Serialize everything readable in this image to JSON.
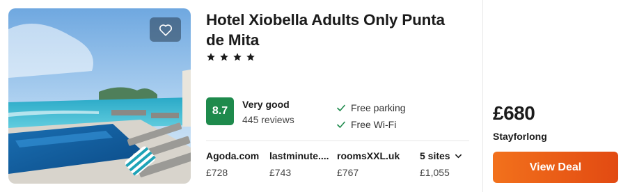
{
  "hotel": {
    "name": "Hotel Xiobella Adults Only Punta de Mita",
    "star_count": 4,
    "star_glyph": "★"
  },
  "rating": {
    "score": "8.7",
    "label": "Very good",
    "reviews": "445 reviews",
    "badge_color": "#1e8a4c"
  },
  "amenities": [
    {
      "label": "Free parking",
      "icon": "check-icon"
    },
    {
      "label": "Free Wi-Fi",
      "icon": "check-icon"
    }
  ],
  "deals": [
    {
      "site": "Agoda.com",
      "price": "£728"
    },
    {
      "site": "lastminute....",
      "price": "£743"
    },
    {
      "site": "roomsXXL.uk",
      "price": "£767"
    }
  ],
  "more_sites": {
    "label": "5 sites",
    "price": "£1,055",
    "icon": "chevron-down-icon"
  },
  "best_deal": {
    "price": "£680",
    "provider": "Stayforlong",
    "button_label": "View Deal",
    "button_color": "#f2711c"
  },
  "favorite": {
    "icon": "heart-icon"
  }
}
